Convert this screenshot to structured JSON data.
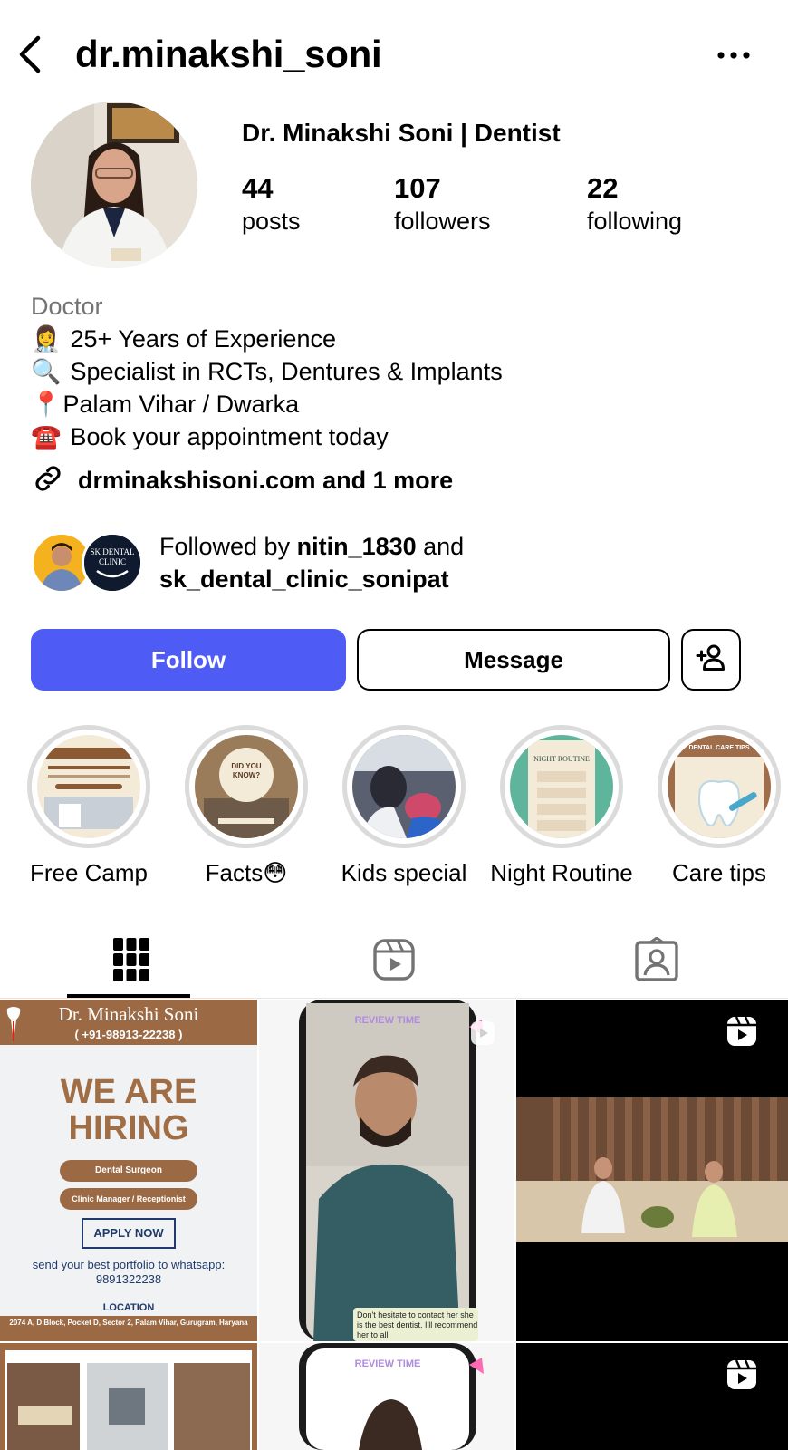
{
  "header": {
    "username": "dr.minakshi_soni",
    "back_icon": "chevron-left-icon",
    "more_icon": "more-horizontal-icon"
  },
  "profile": {
    "display_name": "Dr. Minakshi Soni | Dentist",
    "stats": [
      {
        "value": "44",
        "label": "posts"
      },
      {
        "value": "107",
        "label": "followers"
      },
      {
        "value": "22",
        "label": "following"
      }
    ]
  },
  "bio": {
    "category": "Doctor",
    "lines": [
      {
        "emoji": "👩‍⚕️",
        "text": "25+ Years of Experience"
      },
      {
        "emoji": "🔍",
        "text": "Specialist in RCTs, Dentures & Implants"
      },
      {
        "emoji": "📍",
        "text": "Palam Vihar / Dwarka"
      },
      {
        "emoji": "☎️",
        "text": "Book your appointment today"
      }
    ],
    "link_text": "drminakshisoni.com and 1 more"
  },
  "followed_by": {
    "prefix": "Followed by ",
    "user1": "nitin_1830",
    "joiner": " and",
    "user2": "sk_dental_clinic_sonipat",
    "avatar2_text": "SK DENTAL CLINIC"
  },
  "actions": {
    "follow_label": "Follow",
    "message_label": "Message",
    "follow_color": "#4f5bf5"
  },
  "highlights": [
    {
      "label": "Free Camp"
    },
    {
      "label": "Facts😳"
    },
    {
      "label": "Kids special"
    },
    {
      "label": "Night Routine"
    },
    {
      "label": "Care tips"
    }
  ],
  "highlight_cover_text": {
    "facts": "DID YOU KNOW?",
    "night": "NIGHT ROUTINE",
    "care": "DENTAL CARE TIPS"
  },
  "tabs": [
    {
      "name": "grid-icon",
      "active": true
    },
    {
      "name": "reels-icon",
      "active": false
    },
    {
      "name": "tagged-icon",
      "active": false
    }
  ],
  "posts": {
    "hiring": {
      "doctor": "Dr. Minakshi Soni",
      "phone": "( +91-98913-22238 )",
      "headline1": "WE ARE",
      "headline2": "HIRING",
      "role1": "Dental Surgeon",
      "role2": "Clinic Manager / Receptionist",
      "apply": "APPLY NOW",
      "send1": "send your best portfolio to whatsapp:",
      "send2": "9891322238",
      "location_label": "LOCATION",
      "address": "2074 A, D Block, Pocket D, Sector 2, Palam Vihar, Gurugram, Haryana"
    },
    "review": {
      "tag": "REVIEW TIME",
      "caption": "Don't hesitate to contact her she is the best dentist. I'll recommend her to all"
    },
    "review2_tag": "REVIEW TIME"
  }
}
